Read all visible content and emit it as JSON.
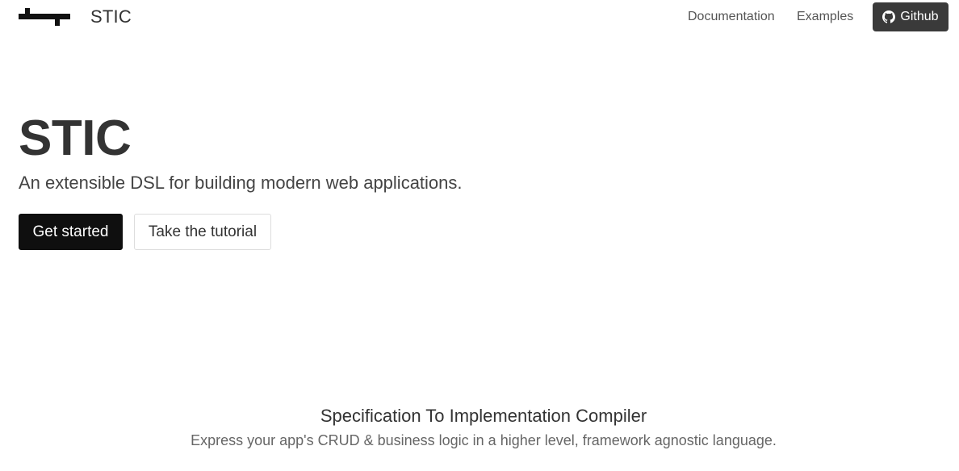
{
  "navbar": {
    "brand_name": "STIC",
    "brand_logo_icon": "stic-logo-icon",
    "links": {
      "documentation": "Documentation",
      "examples": "Examples"
    },
    "github": {
      "label": "Github",
      "icon": "github-icon",
      "bg_color": "#3a3a3a"
    }
  },
  "hero": {
    "title": "STIC",
    "subtitle": "An extensible DSL for building modern web applications.",
    "buttons": {
      "primary": "Get started",
      "secondary": "Take the tutorial"
    }
  },
  "feature": {
    "title": "Specification To Implementation Compiler",
    "description": "Express your app's CRUD & business logic in a higher level, framework agnostic language."
  },
  "colors": {
    "primary_button": "#0f0f0f",
    "text": "#333333"
  }
}
